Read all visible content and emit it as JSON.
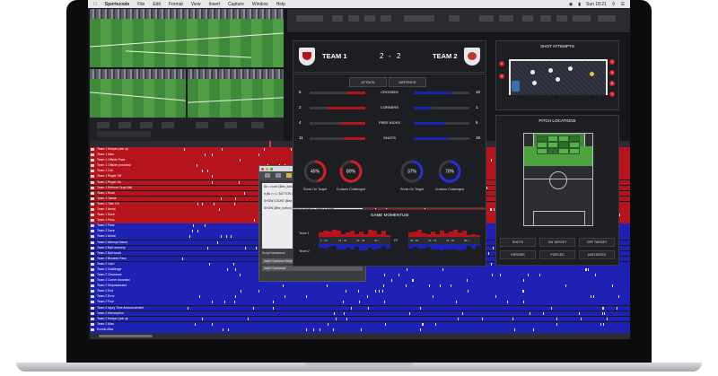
{
  "menubar": {
    "app_name": "Sportscode",
    "items": [
      "File",
      "Edit",
      "Format",
      "View",
      "Insert",
      "Capture",
      "Window",
      "Help"
    ],
    "clock": "Sun 18:21"
  },
  "transport": {
    "labels": [
      "",
      "",
      "",
      ""
    ]
  },
  "timeline": {
    "rows": [
      {
        "label": "Team 1 Keeper pick up",
        "team": "red"
      },
      {
        "label": "Team 1 Miss",
        "team": "red"
      },
      {
        "label": "Team 1 Offside Pass",
        "team": "red"
      },
      {
        "label": "Team 1 Offside provoked",
        "team": "red"
      },
      {
        "label": "Team 1 Out",
        "team": "red"
      },
      {
        "label": "Team 1 Player Off",
        "team": "red"
      },
      {
        "label": "Team 1 Player On",
        "team": "red"
      },
      {
        "label": "Team 1 Referee Drop Ball",
        "team": "red"
      },
      {
        "label": "Team 1 Rush",
        "team": "red"
      },
      {
        "label": "Team 1 Tackle",
        "team": "red"
      },
      {
        "label": "Team 1 Take On",
        "team": "red"
      },
      {
        "label": "Team 1 Aerial",
        "team": "red"
      },
      {
        "label": "Team 1 Save",
        "team": "red"
      },
      {
        "label": "Team 1 Pass",
        "team": "red"
      },
      {
        "label": "Team 2 Pass",
        "team": "blue"
      },
      {
        "label": "Team 2 Save",
        "team": "blue"
      },
      {
        "label": "Team 2 Aerial",
        "team": "blue"
      },
      {
        "label": "Team 2 Attempt Saved",
        "team": "blue"
      },
      {
        "label": "Team 2 Ball recovery",
        "team": "blue"
      },
      {
        "label": "Team 2 Ball touch",
        "team": "blue"
      },
      {
        "label": "Team 2 Blocked Pass",
        "team": "blue"
      },
      {
        "label": "Team 2 Card",
        "team": "blue"
      },
      {
        "label": "Team 2 Challenge",
        "team": "blue"
      },
      {
        "label": "Team 2 Clearance",
        "team": "blue"
      },
      {
        "label": "Team 2 Corner Awarded",
        "team": "blue"
      },
      {
        "label": "Team 2 Dispossessed",
        "team": "blue"
      },
      {
        "label": "Team 2 End",
        "team": "blue"
      },
      {
        "label": "Team 2 Error",
        "team": "blue"
      },
      {
        "label": "Team 2 Foul",
        "team": "blue"
      },
      {
        "label": "Team 2 Injury Time Announcement",
        "team": "blue"
      },
      {
        "label": "Team 2 Interception",
        "team": "blue"
      },
      {
        "label": "Team 2 Keeper pick up",
        "team": "blue"
      },
      {
        "label": "Team 2 Miss",
        "team": "blue"
      },
      {
        "label": "Evento Alba",
        "team": "blue"
      }
    ]
  },
  "inspector": {
    "title": "Inspector",
    "lines": [
      "$s = count ($the_button where row = \"Team 1 Shots\"",
      "if ($s >= 1, BUTTON OPACITY 100, BUTTON OPACITY 0)",
      "SHOW COUNT ($the_button WHERE ROW = \"Team 1 Shots\"",
      "SHOW ($the_button) WHERE ROW = \"Team 1 Shots\""
    ],
    "section_label": "Script Assistance",
    "selects": [
      "Insert Common Script",
      "Insert Command"
    ]
  },
  "scoreboard": {
    "team1": "TEAM 1",
    "team2": "TEAM 2",
    "score1": "2",
    "separator": "-",
    "score2": "2"
  },
  "stats": {
    "tabs": [
      "ATTACK",
      "DEFENCE"
    ],
    "rows": [
      {
        "label": "CROSSES",
        "left": "5",
        "right": "10",
        "left_frac": 0.33,
        "right_frac": 0.67
      },
      {
        "label": "CORNERS",
        "left": "2",
        "right": "1",
        "left_frac": 0.67,
        "right_frac": 0.33
      },
      {
        "label": "FREE KICKS",
        "left": "4",
        "right": "5",
        "left_frac": 0.44,
        "right_frac": 0.56
      },
      {
        "label": "SHOTS",
        "left": "11",
        "right": "18",
        "left_frac": 0.38,
        "right_frac": 0.62
      }
    ],
    "donuts": [
      {
        "value": "45%",
        "fraction": 0.45,
        "caption": "Shots On Target",
        "color": "#d21f26"
      },
      {
        "value": "80%",
        "fraction": 0.8,
        "caption": "Crosses Challenged",
        "color": "#d21f26"
      },
      {
        "value": "37%",
        "fraction": 0.37,
        "caption": "Shots On Target",
        "color": "#2430d6"
      },
      {
        "value": "70%",
        "fraction": 0.7,
        "caption": "Crosses Challenged",
        "color": "#2430d6"
      }
    ]
  },
  "momentum": {
    "title": "GAME MOMENTUM",
    "team1": "Team 1",
    "team2": "Team 2",
    "segments": [
      "1 - 15",
      "16 - 30",
      "31 - 45",
      "45 +"
    ],
    "segments2": [
      "46 - 60",
      "61 - 75",
      "76 - 90",
      "90 +"
    ],
    "ht": "HT"
  },
  "shot_attempts": {
    "title": "SHOT ATTEMPTS",
    "left_markers": [
      "4",
      "4"
    ],
    "right_markers": [
      "4",
      "5",
      "8",
      "1"
    ]
  },
  "pitch_locations": {
    "title": "PITCH LOCATIONS",
    "buttons": [
      "SHOTS",
      "ON TARGET",
      "OFF TARGET",
      "ERRORS",
      "FORCED",
      "UNFORCED"
    ]
  },
  "colors": {
    "team1": "#b5141c",
    "team2": "#1d22b5",
    "panel": "#1d1e22",
    "field": "#3f8a3a"
  }
}
